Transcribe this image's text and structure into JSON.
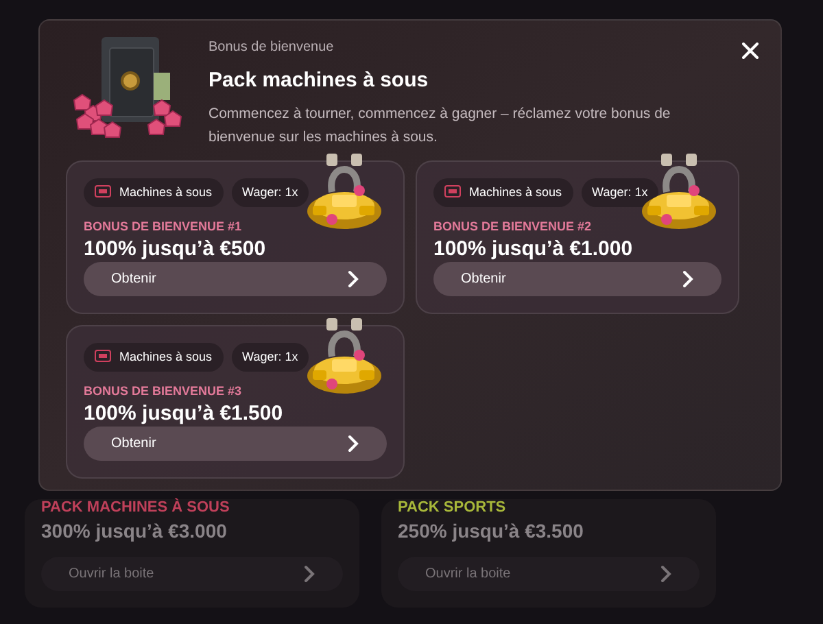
{
  "background_cards": [
    {
      "label": "PACK MACHINES À SOUS",
      "color": "#c0405a",
      "amount": "300% jusqu’à €3.000",
      "button": "Ouvrir la boite"
    },
    {
      "label": "PACK SPORTS",
      "color": "#a8b83a",
      "amount": "250% jusqu’à €3.500",
      "button": "Ouvrir la boite"
    }
  ],
  "modal": {
    "subtitle": "Bonus de bienvenue",
    "title": "Pack machines à sous",
    "description": "Commencez à tourner, commencez à gagner – réclamez votre bonus de bienvenue sur les machines à sous.",
    "offers": [
      {
        "category": "Machines à sous",
        "wager": "Wager: 1x",
        "label": "BONUS DE BIENVENUE #1",
        "amount": "100% jusqu’à €500",
        "button": "Obtenir"
      },
      {
        "category": "Machines à sous",
        "wager": "Wager: 1x",
        "label": "BONUS DE BIENVENUE #2",
        "amount": "100% jusqu’à €1.000",
        "button": "Obtenir"
      },
      {
        "category": "Machines à sous",
        "wager": "Wager: 1x",
        "label": "BONUS DE BIENVENUE #3",
        "amount": "100% jusqu’à €1.500",
        "button": "Obtenir"
      }
    ]
  }
}
